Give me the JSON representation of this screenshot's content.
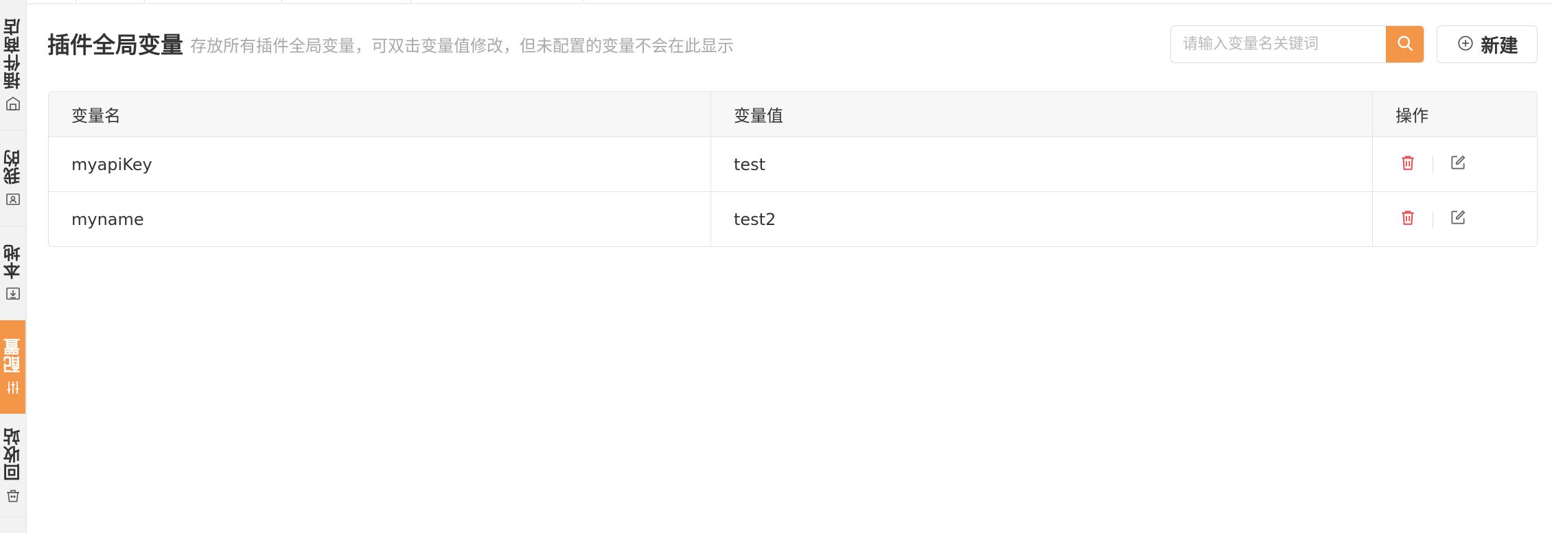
{
  "sidebar": {
    "tabs": [
      {
        "label": "插件商店",
        "icon": "store-icon",
        "active": false
      },
      {
        "label": "我的",
        "icon": "user-folder-icon",
        "active": false
      },
      {
        "label": "本地",
        "icon": "download-icon",
        "active": false
      },
      {
        "label": "配置",
        "icon": "sliders-icon",
        "active": true
      },
      {
        "label": "回收站",
        "icon": "trash-bin-icon",
        "active": false
      }
    ]
  },
  "header": {
    "title": "插件全局变量",
    "description": "存放所有插件全局变量，可双击变量值修改，但未配置的变量不会在此显示"
  },
  "search": {
    "placeholder": "请输入变量名关键词",
    "value": ""
  },
  "toolbar": {
    "new_label": "新建"
  },
  "table": {
    "columns": [
      "变量名",
      "变量值",
      "操作"
    ],
    "rows": [
      {
        "name": "myapiKey",
        "value": "test"
      },
      {
        "name": "myname",
        "value": "test2"
      }
    ]
  },
  "colors": {
    "accent": "#f49648",
    "delete": "#e5484d",
    "border": "#e3e3e3"
  }
}
